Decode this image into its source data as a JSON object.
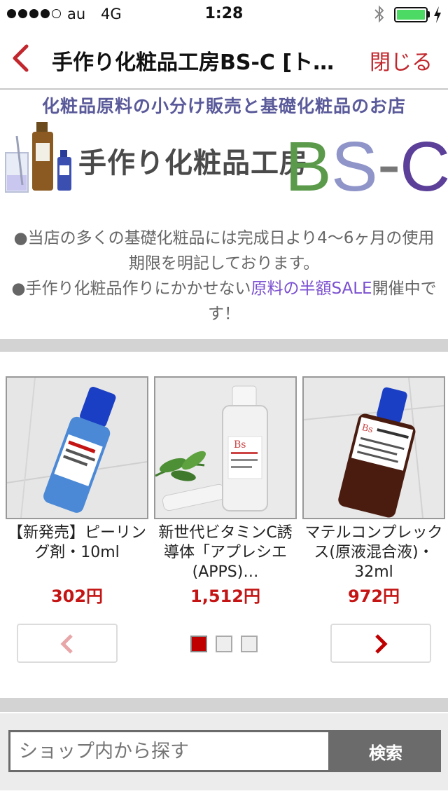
{
  "status_bar": {
    "carrier": "au",
    "network": "4G",
    "time": "1:28",
    "signal_filled": 4,
    "signal_total": 5,
    "battery_level": 1.0,
    "battery_color": "#4cd964"
  },
  "nav": {
    "title": "手作り化粧品工房BS-C [ト…",
    "close_label": "閉じる",
    "back_icon": "chevron-left-icon",
    "accent_color": "#c1272d"
  },
  "banner": {
    "tagline": "化粧品原料の小分け販売と基礎化粧品のお店",
    "shop_name": "手作り化粧品工房",
    "logo_letters": [
      "B",
      "S",
      "-",
      "C"
    ],
    "logo_colors": [
      "#5a9a4a",
      "#8f94c9",
      "#777777",
      "#5b3f99"
    ]
  },
  "notice": {
    "line1": "●当店の多くの基礎化粧品には完成日より4〜6ヶ月の使用期限を明記しております。",
    "line2_pre": "●手作り化粧品作りにかかせない",
    "line2_link": "原料の半額SALE",
    "line2_post": "開催中です！"
  },
  "products": [
    {
      "name": "【新発売】ピーリング剤・10ml",
      "price": "302円"
    },
    {
      "name": "新世代ビタミンC誘導体「アプレシエ(APPS)…",
      "price": "1,512円"
    },
    {
      "name": "マテルコンプレックス(原液混合液)・32ml",
      "price": "972円"
    }
  ],
  "pager": {
    "prev_icon": "chevron-left-icon",
    "next_icon": "chevron-right-icon",
    "pages": 3,
    "current": 1
  },
  "search": {
    "placeholder": "ショップ内から探す",
    "button_label": "検索"
  }
}
